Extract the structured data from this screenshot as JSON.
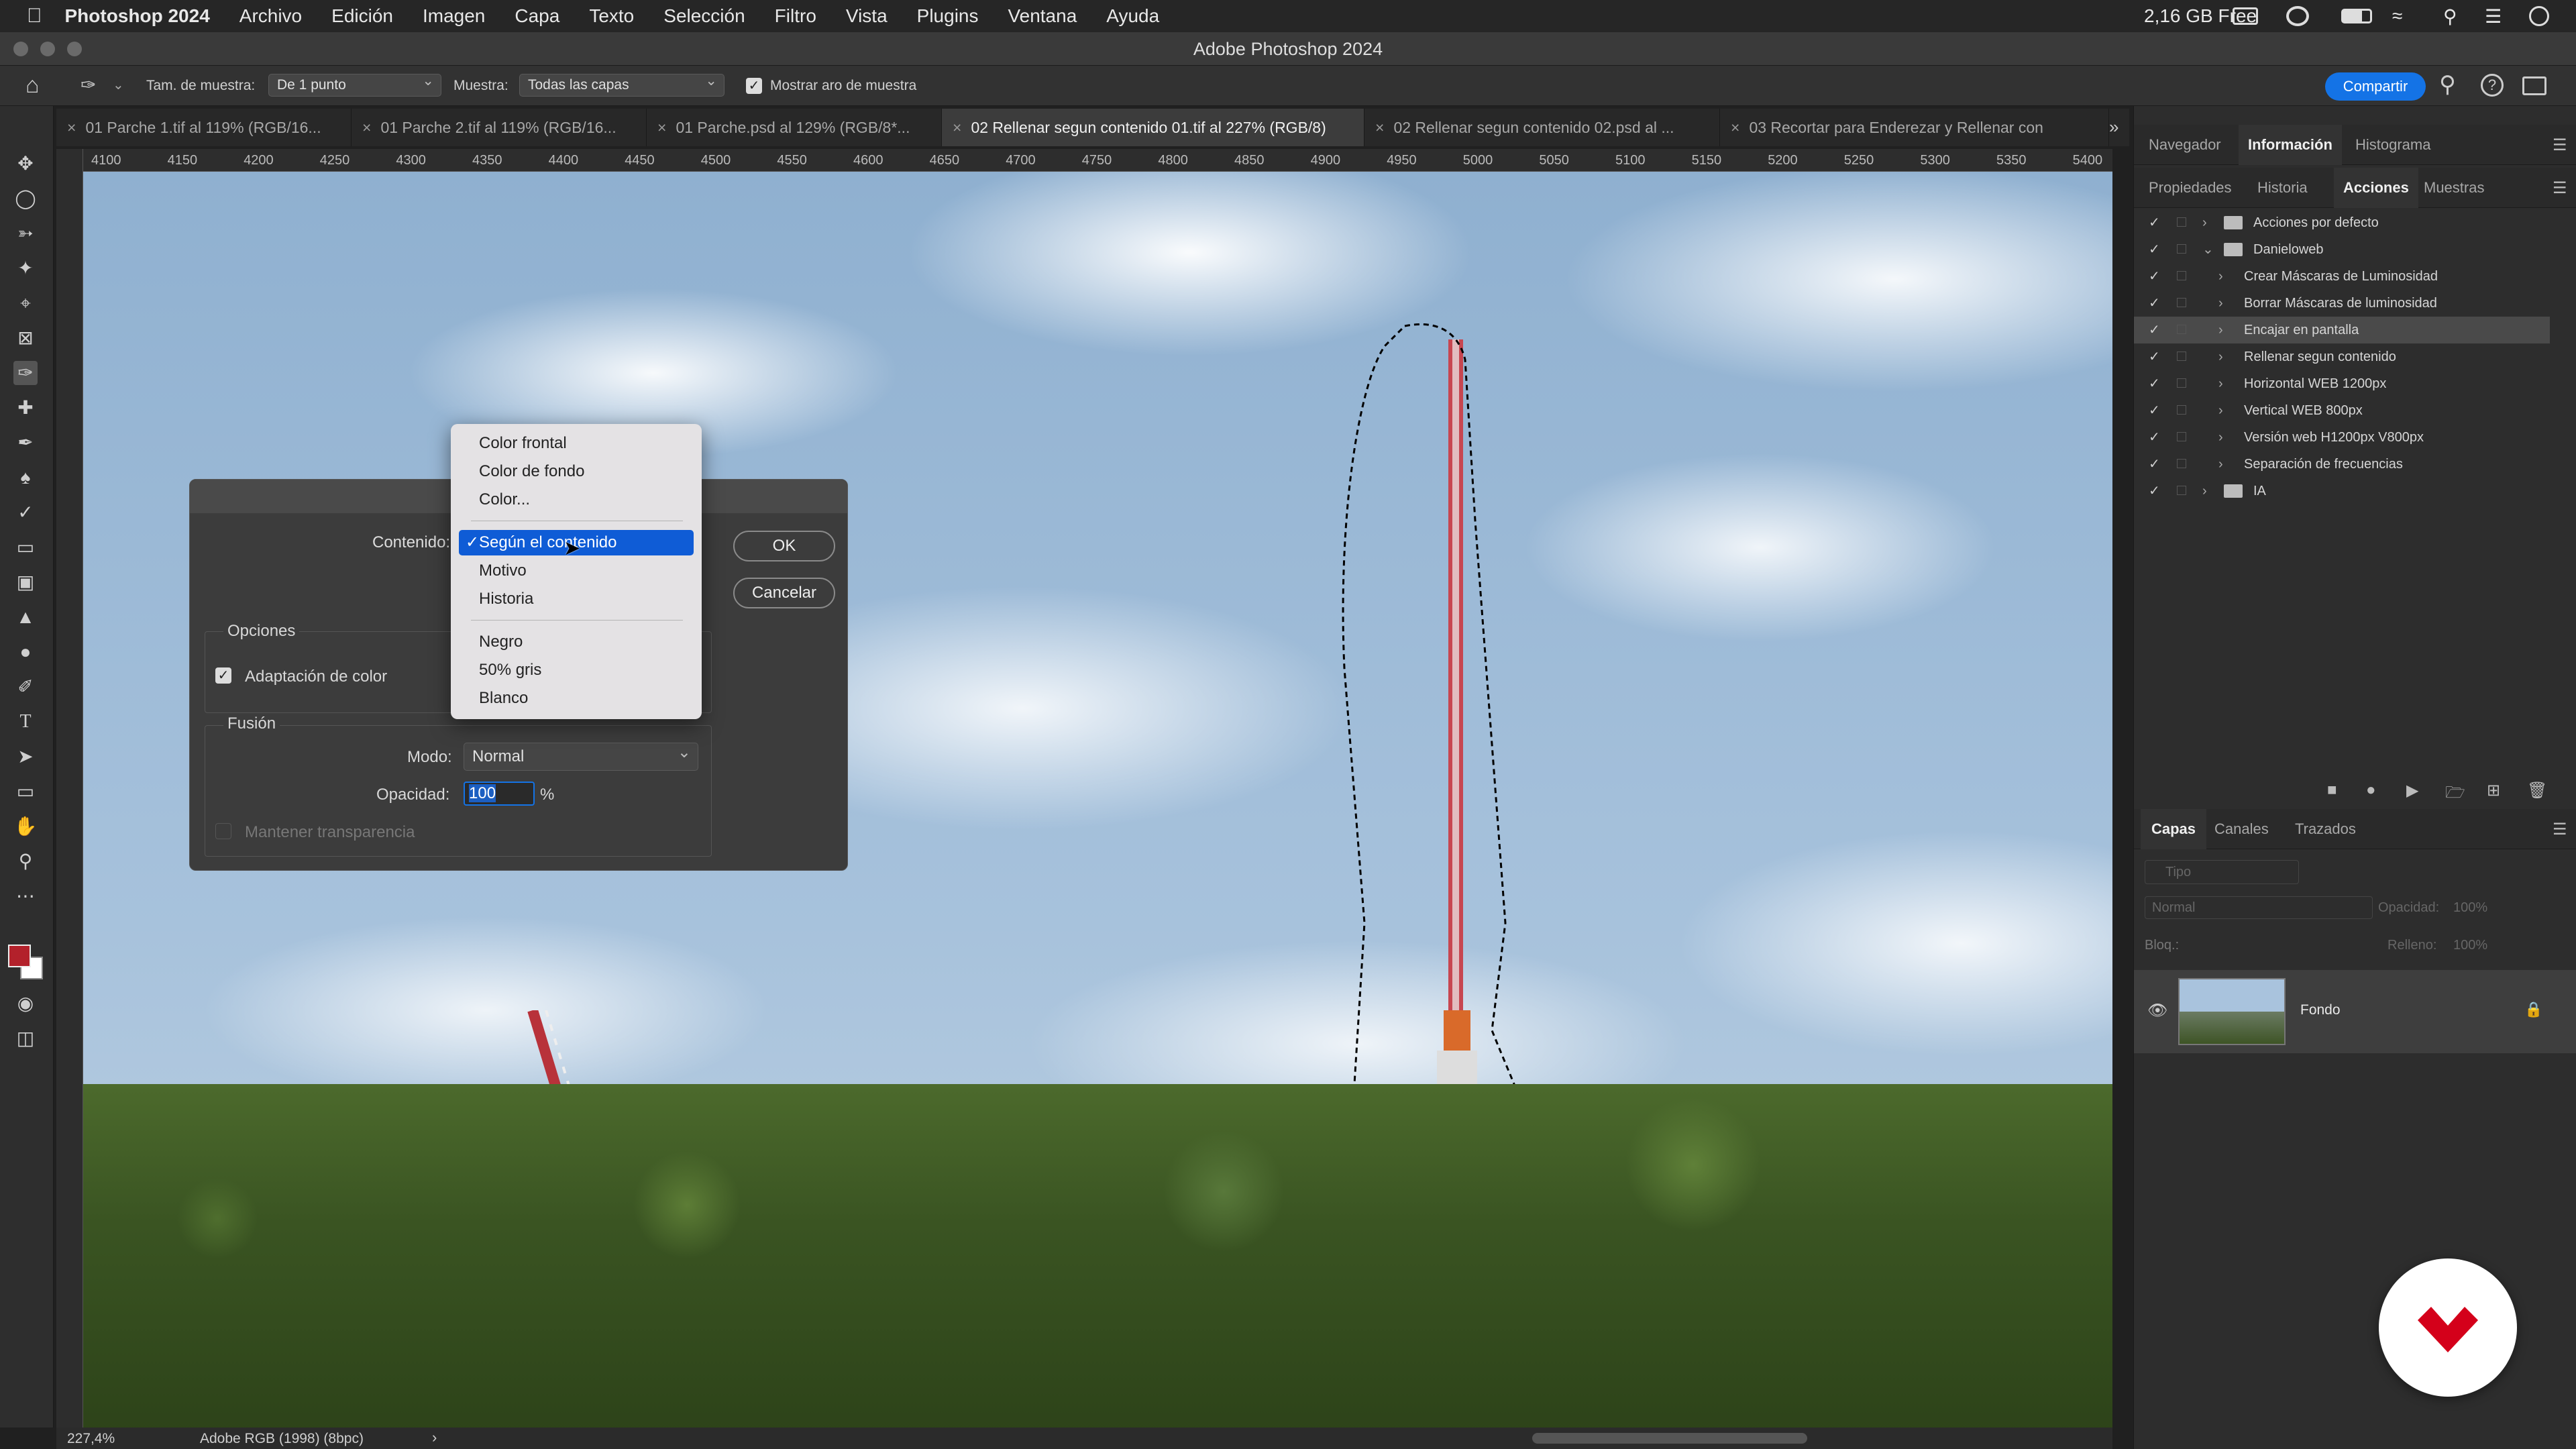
{
  "menubar": {
    "app": "Photoshop 2024",
    "items": [
      "Archivo",
      "Edición",
      "Imagen",
      "Capa",
      "Texto",
      "Selección",
      "Filtro",
      "Vista",
      "Plugins",
      "Ventana",
      "Ayuda"
    ],
    "memory": "2,16 GB Free"
  },
  "window_title": "Adobe Photoshop 2024",
  "options": {
    "sample_size_label": "Tam. de muestra:",
    "sample_size_value": "De 1 punto",
    "sample_label": "Muestra:",
    "sample_value": "Todas las capas",
    "show_ring_label": "Mostrar aro de muestra",
    "share": "Compartir"
  },
  "tabs": [
    "01 Parche 1.tif al 119% (RGB/16...",
    "01 Parche 2.tif al 119% (RGB/16...",
    "01 Parche.psd al 129% (RGB/8*...",
    "02 Rellenar segun contenido 01.tif al 227% (RGB/8)",
    "02 Rellenar segun contenido 02.psd al ...",
    "03 Recortar para Enderezar y Rellenar con"
  ],
  "ruler": [
    "4100",
    "4150",
    "4200",
    "4250",
    "4300",
    "4350",
    "4400",
    "4450",
    "4500",
    "4550",
    "4600",
    "4650",
    "4700",
    "4750",
    "4800",
    "4850",
    "4900",
    "4950",
    "5000",
    "5050",
    "5100",
    "5150",
    "5200",
    "5250",
    "5300",
    "5350",
    "5400"
  ],
  "status": {
    "zoom": "227,4%",
    "profile": "Adobe RGB (1998) (8bpc)"
  },
  "panel_top": {
    "tabs": [
      "Navegador",
      "Información",
      "Histograma"
    ]
  },
  "panel_mid": {
    "tabs": [
      "Propiedades",
      "Historia",
      "Acciones",
      "Muestras"
    ],
    "actions": [
      {
        "label": "Acciones por defecto",
        "folder": true,
        "indent": 0
      },
      {
        "label": "Danieloweb",
        "folder": true,
        "indent": 0,
        "open": true
      },
      {
        "label": "Crear Máscaras de Luminosidad",
        "indent": 1
      },
      {
        "label": "Borrar Máscaras de luminosidad",
        "indent": 1
      },
      {
        "label": "Encajar en pantalla",
        "indent": 1,
        "highlight": true
      },
      {
        "label": "Rellenar segun contenido",
        "indent": 1
      },
      {
        "label": "Horizontal WEB 1200px",
        "indent": 1
      },
      {
        "label": "Vertical WEB 800px",
        "indent": 1
      },
      {
        "label": "Versión web H1200px V800px",
        "indent": 1
      },
      {
        "label": "Separación de frecuencias",
        "indent": 1
      },
      {
        "label": "IA",
        "folder": true,
        "indent": 0
      }
    ]
  },
  "layers": {
    "tabs": [
      "Capas",
      "Canales",
      "Trazados"
    ],
    "search_placeholder": "Tipo",
    "blend": "Normal",
    "opacity_label": "Opacidad:",
    "opacity": "100%",
    "lock_label": "Bloq.:",
    "fill_label": "Relleno:",
    "fill": "100%",
    "layer_name": "Fondo"
  },
  "dialog": {
    "contenido_label": "Contenido:",
    "ok": "OK",
    "cancel": "Cancelar",
    "options_legend": "Opciones",
    "color_adapt": "Adaptación de color",
    "fusion_legend": "Fusión",
    "mode_label": "Modo:",
    "mode_value": "Normal",
    "opacity_label": "Opacidad:",
    "opacity_value": "100",
    "percent": "%",
    "keep_transparency": "Mantener transparencia"
  },
  "popup": {
    "items": [
      "Color frontal",
      "Color de fondo",
      "Color...",
      "Según el contenido",
      "Motivo",
      "Historia",
      "Negro",
      "50% gris",
      "Blanco"
    ],
    "selected": "Según el contenido"
  },
  "colors": {
    "accent": "#1473e6",
    "selection": "#0f5cd6",
    "logo": "#d4001a",
    "foreground": "#b3212b"
  }
}
